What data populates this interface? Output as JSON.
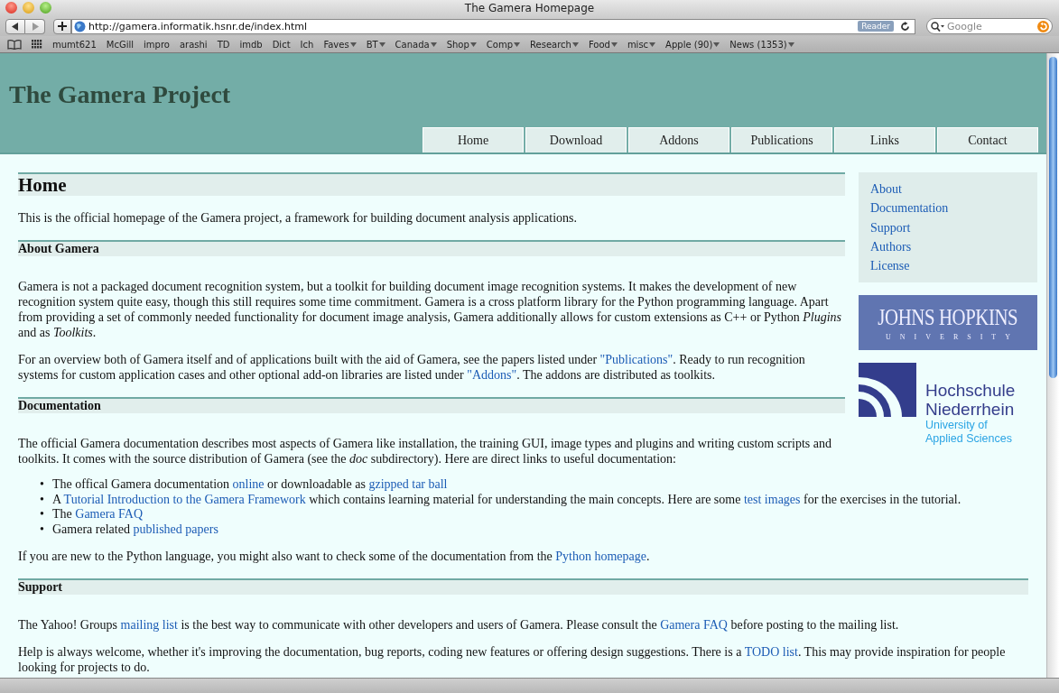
{
  "window": {
    "title": "The Gamera Homepage"
  },
  "toolbar": {
    "url": "http://gamera.informatik.hsnr.de/index.html",
    "reader_button": "Reader",
    "search": {
      "placeholder": "Google"
    }
  },
  "bookmarks": [
    {
      "label": "mumt621",
      "menu": false
    },
    {
      "label": "McGill",
      "menu": false
    },
    {
      "label": "impro",
      "menu": false
    },
    {
      "label": "arashi",
      "menu": false
    },
    {
      "label": "TD",
      "menu": false
    },
    {
      "label": "imdb",
      "menu": false
    },
    {
      "label": "Dict",
      "menu": false
    },
    {
      "label": "Ich",
      "menu": false
    },
    {
      "label": "Faves",
      "menu": true
    },
    {
      "label": "BT",
      "menu": true
    },
    {
      "label": "Canada",
      "menu": true
    },
    {
      "label": "Shop",
      "menu": true
    },
    {
      "label": "Comp",
      "menu": true
    },
    {
      "label": "Research",
      "menu": true
    },
    {
      "label": "Food",
      "menu": true
    },
    {
      "label": "misc",
      "menu": true
    },
    {
      "label": "Apple (90)",
      "menu": true
    },
    {
      "label": "News (1353)",
      "menu": true
    }
  ],
  "site": {
    "title": "The Gamera Project",
    "nav": [
      "Home",
      "Download",
      "Addons",
      "Publications",
      "Links",
      "Contact"
    ]
  },
  "sidebar": {
    "links": [
      "About",
      "Documentation",
      "Support",
      "Authors",
      "License"
    ],
    "logos": [
      {
        "kind": "jhu",
        "name": "JOHNS HOPKINS",
        "sub": "UNIVERSITY"
      },
      {
        "kind": "hsnr",
        "name": [
          "Hochschule",
          "Niederrhein"
        ],
        "sub": [
          "University of",
          "Applied Sciences"
        ]
      }
    ]
  },
  "content": {
    "heading": "Home",
    "blocks": [
      {
        "kind": "paragraph",
        "segments": [
          {
            "kind": "text",
            "t": "This is the official homepage of the Gamera project, a framework for building document analysis applications."
          }
        ]
      },
      {
        "kind": "section",
        "text": "About Gamera"
      },
      {
        "kind": "paragraph",
        "segments": [
          {
            "kind": "text",
            "t": "Gamera is not a packaged document recognition system, but a toolkit for building document image recognition systems. It makes the development of new recognition system quite easy, though this still requires some time commitment. Gamera is a cross platform library for the Python programming language. Apart from providing a set of commonly needed functionality for document image analysis, Gamera additionally allows for custom extensions as C++ or Python "
          },
          {
            "kind": "italic",
            "t": "Plugins"
          },
          {
            "kind": "text",
            "t": " and as "
          },
          {
            "kind": "italic",
            "t": "Toolkits"
          },
          {
            "kind": "text",
            "t": "."
          }
        ]
      },
      {
        "kind": "paragraph",
        "segments": [
          {
            "kind": "text",
            "t": "For an overview both of Gamera itself and of applications built with the aid of Gamera, see the papers listed under "
          },
          {
            "kind": "link",
            "t": "\"Publications\""
          },
          {
            "kind": "text",
            "t": ". Ready to run recognition systems for custom application cases and other optional add-on libraries are listed under "
          },
          {
            "kind": "link",
            "t": "\"Addons\""
          },
          {
            "kind": "text",
            "t": ". The addons are distributed as toolkits."
          }
        ]
      },
      {
        "kind": "section",
        "text": "Documentation"
      },
      {
        "kind": "paragraph",
        "segments": [
          {
            "kind": "text",
            "t": "The official Gamera documentation describes most aspects of Gamera like installation, the training GUI, image types and plugins and writing custom scripts and toolkits. It comes with the source distribution of Gamera (see the "
          },
          {
            "kind": "italic",
            "t": "doc"
          },
          {
            "kind": "text",
            "t": " subdirectory). Here are direct links to useful documentation:"
          }
        ]
      },
      {
        "kind": "list",
        "marker": "•",
        "items": [
          [
            {
              "kind": "text",
              "t": "The offical Gamera documentation "
            },
            {
              "kind": "link",
              "t": "online"
            },
            {
              "kind": "text",
              "t": " or downloadable as "
            },
            {
              "kind": "link",
              "t": "gzipped tar ball"
            }
          ],
          [
            {
              "kind": "text",
              "t": "A "
            },
            {
              "kind": "link",
              "t": "Tutorial Introduction to the Gamera Framework"
            },
            {
              "kind": "text",
              "t": " which contains learning material for understanding the main concepts. Here are some "
            },
            {
              "kind": "link",
              "t": "test images"
            },
            {
              "kind": "text",
              "t": " for the exercises in the tutorial."
            }
          ],
          [
            {
              "kind": "text",
              "t": "The "
            },
            {
              "kind": "link",
              "t": "Gamera FAQ"
            }
          ],
          [
            {
              "kind": "text",
              "t": "Gamera related "
            },
            {
              "kind": "link",
              "t": "published papers"
            }
          ]
        ]
      },
      {
        "kind": "paragraph",
        "segments": [
          {
            "kind": "text",
            "t": "If you are new to the Python language, you might also want to check some of the documentation from the "
          },
          {
            "kind": "link",
            "t": "Python homepage"
          },
          {
            "kind": "text",
            "t": "."
          }
        ]
      },
      {
        "kind": "section",
        "text": "Support"
      },
      {
        "kind": "paragraph",
        "segments": [
          {
            "kind": "text",
            "t": "The Yahoo! Groups "
          },
          {
            "kind": "link",
            "t": "mailing list"
          },
          {
            "kind": "text",
            "t": " is the best way to communicate with other developers and users of Gamera. Please consult the "
          },
          {
            "kind": "link",
            "t": "Gamera FAQ"
          },
          {
            "kind": "text",
            "t": " before posting to the mailing list."
          }
        ]
      },
      {
        "kind": "paragraph",
        "segments": [
          {
            "kind": "text",
            "t": "Help is always welcome, whether it's improving the documentation, bug reports, coding new features or offering design suggestions. There is a "
          },
          {
            "kind": "link",
            "t": "TODO list"
          },
          {
            "kind": "text",
            "t": ". This may provide inspiration for people looking for projects to do."
          }
        ]
      }
    ]
  }
}
